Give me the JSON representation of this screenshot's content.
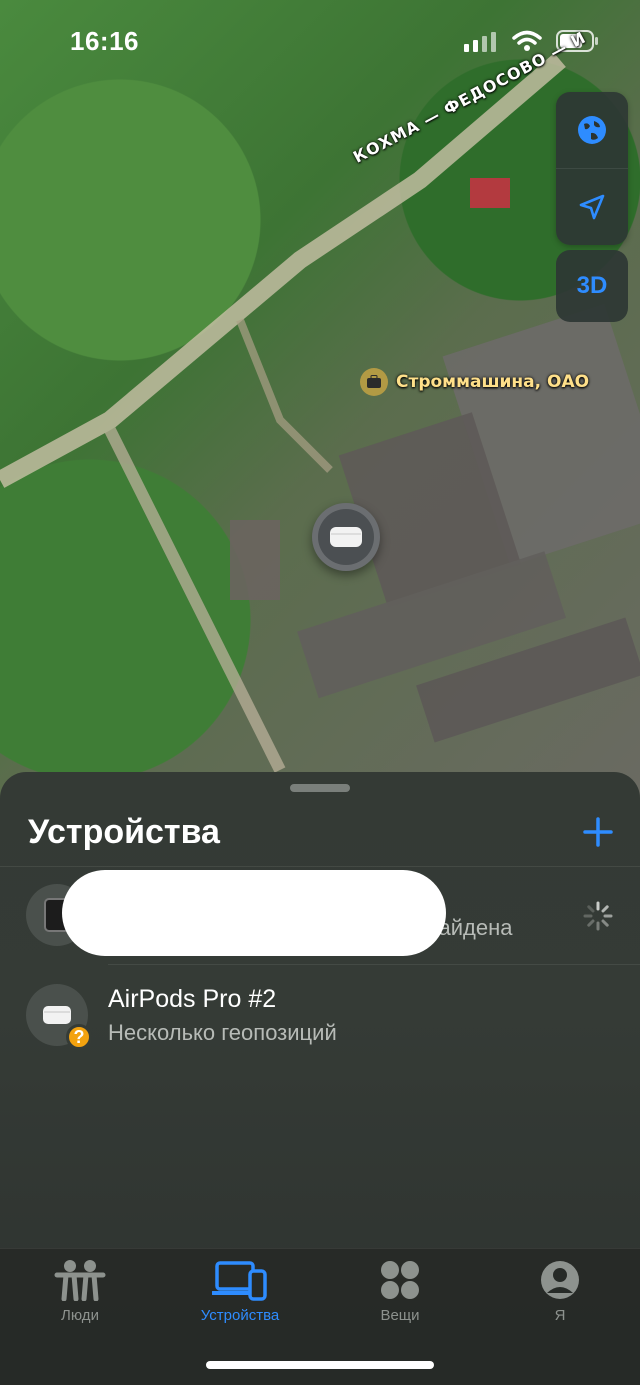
{
  "status": {
    "time": "16:16"
  },
  "map": {
    "road_label": "КОХМА — ФЕДОСОВО — И",
    "poi_label": "Строммашина, ОАО",
    "three_d_label": "3D"
  },
  "sheet": {
    "title": "Устройства",
    "items": [
      {
        "name": "",
        "subtitle": "е найдена",
        "status": "loading"
      },
      {
        "name": "AirPods Pro #2",
        "subtitle": "Несколько геопозиций",
        "badge": "?"
      }
    ]
  },
  "tabs": [
    {
      "label": "Люди",
      "icon": "people-icon",
      "active": false
    },
    {
      "label": "Устройства",
      "icon": "devices-icon",
      "active": true
    },
    {
      "label": "Вещи",
      "icon": "items-icon",
      "active": false
    },
    {
      "label": "Я",
      "icon": "me-icon",
      "active": false
    }
  ],
  "colors": {
    "accent": "#2e8cff",
    "badge": "#f3a20f"
  }
}
